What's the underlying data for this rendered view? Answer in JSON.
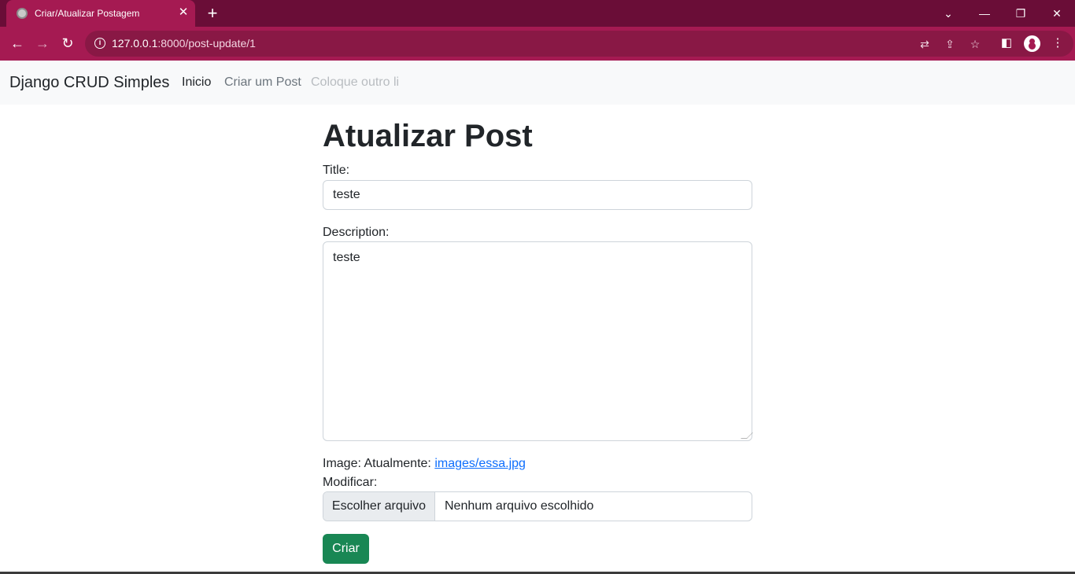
{
  "browser": {
    "tab_title": "Criar/Atualizar Postagem",
    "tab_close": "✕",
    "new_tab": "+",
    "url_host": "127.0.0.1",
    "url_path": ":8000/post-update/1",
    "window_controls": {
      "tab_search": "⌄",
      "minimize": "—",
      "restore": "❐",
      "close": "✕"
    },
    "nav": {
      "back": "←",
      "forward": "→",
      "reload": "↻"
    },
    "icons": [
      "info-icon",
      "translate-icon",
      "share-icon",
      "bookmark-star-icon",
      "side-panel-icon",
      "profile-icon",
      "menu-icon"
    ],
    "accent_color": "#a51a52",
    "tabstrip_color": "#6a0d37"
  },
  "navbar": {
    "brand": "Django CRUD Simples",
    "links": [
      {
        "label": "Inicio",
        "active": true
      },
      {
        "label": "Criar um Post",
        "active": false
      },
      {
        "label": "Coloque outro li",
        "disabled": true
      }
    ]
  },
  "form": {
    "heading": "Atualizar Post",
    "title_label": "Title:",
    "title_value": "teste",
    "description_label": "Description:",
    "description_value": "teste",
    "image_label": "Image: Atualmente:",
    "image_current": "images/essa.jpg",
    "modify_label": "Modificar:",
    "file_button": "Escolher arquivo",
    "file_status": "Nenhum arquivo escolhido",
    "submit_label": "Criar",
    "submit_color": "#198754",
    "link_color": "#0d6efd"
  }
}
